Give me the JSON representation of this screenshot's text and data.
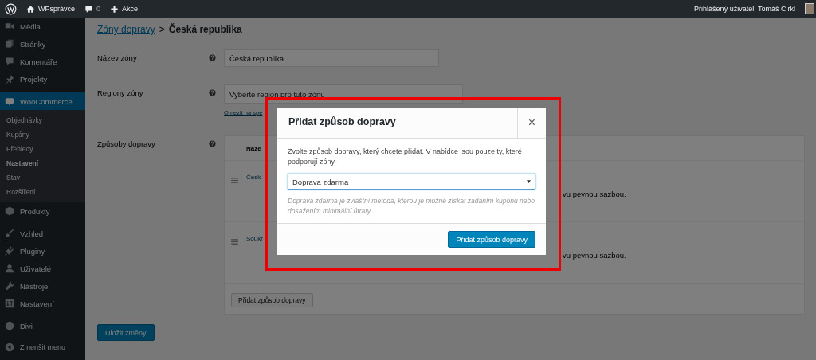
{
  "admin_bar": {
    "site": "WPsprávce",
    "comments": "0",
    "new": "Akce",
    "user": "Přihlášený uživatel: Tomáš Cirkl"
  },
  "sidebar": {
    "sections": [
      [
        {
          "label": "Média",
          "selected": false
        },
        {
          "label": "Stránky",
          "selected": false
        },
        {
          "label": "Komentáře",
          "selected": false
        },
        {
          "label": "Projekty",
          "selected": false
        }
      ],
      [
        {
          "label": "WooCommerce",
          "selected": true,
          "submenu": [
            {
              "label": "Objednávky",
              "selected": false
            },
            {
              "label": "Kupóny",
              "selected": false
            },
            {
              "label": "Přehledy",
              "selected": false
            },
            {
              "label": "Nastavení",
              "selected": true
            },
            {
              "label": "Stav",
              "selected": false
            },
            {
              "label": "Rozšíření",
              "selected": false
            }
          ]
        },
        {
          "label": "Produkty",
          "selected": false
        }
      ],
      [
        {
          "label": "Vzhled",
          "selected": false
        },
        {
          "label": "Pluginy",
          "selected": false
        },
        {
          "label": "Uživatelé",
          "selected": false
        },
        {
          "label": "Nástroje",
          "selected": false
        },
        {
          "label": "Nastavení",
          "selected": false
        }
      ],
      [
        {
          "label": "Divi",
          "selected": false
        }
      ]
    ],
    "collapse": "Zmenšit menu"
  },
  "breadcrumb": {
    "link": "Zóny dopravy",
    "separator": ">",
    "current": "Česká republika"
  },
  "form": [
    {
      "label": "Název zóny",
      "kind": "text",
      "value": "Česká republika"
    },
    {
      "label": "Regiony zóny",
      "kind": "select",
      "placeholder": "Vyberte region pro tuto zónu",
      "link": "Omezit na spe"
    },
    {
      "label": "Způsoby dopravy",
      "kind": "methods",
      "header": "Náze",
      "rows": [
        {
          "name": "Česk",
          "description": "vu pevnou sazbou."
        },
        {
          "name": "Soukr",
          "description": "vu pevnou sazbou."
        }
      ],
      "button": "Přidat způsob dopravy"
    }
  ],
  "save_button": "Uložit změny",
  "modal": {
    "title": "Přidat způsob dopravy",
    "close": "×",
    "intro": "Zvolte způsob dopravy, který chcete přidat. V nabídce jsou pouze ty, které podporují zóny.",
    "select": {
      "value": "Doprava zdarma"
    },
    "description": "Doprava zdarma je zvláštní metoda, kterou je možné získat zadáním kupónu nebo dosažením minimální útraty.",
    "button": "Přidat způsob dopravy"
  }
}
